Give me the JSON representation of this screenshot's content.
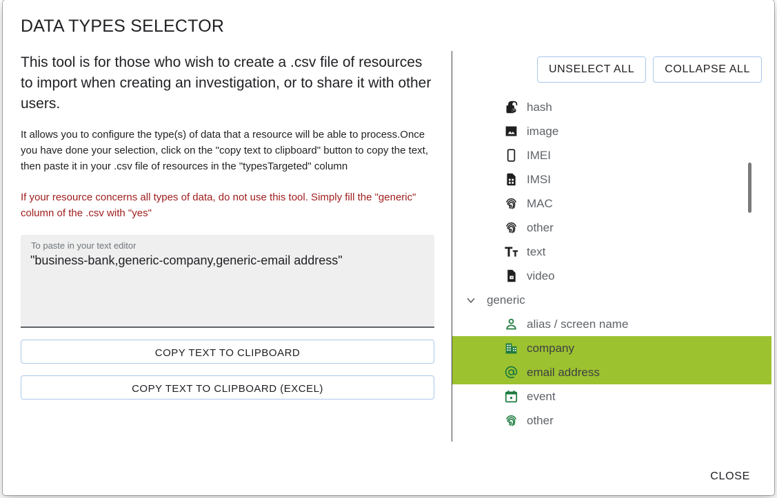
{
  "dialog": {
    "title": "DATA TYPES SELECTOR",
    "close_label": "CLOSE"
  },
  "left": {
    "intro": "This tool is for those who wish to create a .csv file of resources to import when creating an investigation, or to share it with other users.",
    "description": "It allows you to configure the type(s) of data that a resource will be able to process.Once you have done your selection, click on the \"copy text to clipboard\" button to copy the text, then paste it in your .csv file of resources in the \"typesTargeted\" column",
    "warning": "If your resource concerns all types of data, do not use this tool. Simply fill the \"generic\" column of the .csv with \"yes\"",
    "textarea": {
      "label": "To paste in your text editor",
      "value": "\"business-bank,generic-company,generic-email address\"",
      "placeholder": "To paste in your text editor"
    },
    "copy_button": "COPY TEXT TO CLIPBOARD",
    "copy_excel_button": "COPY TEXT TO CLIPBOARD (EXCEL)"
  },
  "right": {
    "unselect_all_label": "UNSELECT ALL",
    "collapse_all_label": "COLLAPSE ALL",
    "tree": [
      {
        "label": "hash",
        "icon": "lock-icon",
        "level": "root",
        "selected": false,
        "expandable": false
      },
      {
        "label": "image",
        "icon": "image-icon",
        "level": "root",
        "selected": false,
        "expandable": false
      },
      {
        "label": "IMEI",
        "icon": "phone-icon",
        "level": "root",
        "selected": false,
        "expandable": false
      },
      {
        "label": "IMSI",
        "icon": "sim-card-icon",
        "level": "root",
        "selected": false,
        "expandable": false
      },
      {
        "label": "MAC",
        "icon": "fingerprint-icon",
        "level": "root",
        "selected": false,
        "expandable": false
      },
      {
        "label": "other",
        "icon": "fingerprint-icon",
        "level": "root",
        "selected": false,
        "expandable": false
      },
      {
        "label": "text",
        "icon": "text-format-icon",
        "level": "root",
        "selected": false,
        "expandable": false
      },
      {
        "label": "video",
        "icon": "video-file-icon",
        "level": "root",
        "selected": false,
        "expandable": false
      },
      {
        "label": "generic",
        "icon": "none",
        "level": "group",
        "selected": false,
        "expandable": true
      },
      {
        "label": "alias / screen name",
        "icon": "person-icon",
        "level": "child",
        "selected": false,
        "expandable": false
      },
      {
        "label": "company",
        "icon": "building-icon",
        "level": "child",
        "selected": true,
        "expandable": false
      },
      {
        "label": "email address",
        "icon": "at-sign-icon",
        "level": "child",
        "selected": true,
        "expandable": false
      },
      {
        "label": "event",
        "icon": "calendar-icon",
        "level": "child",
        "selected": false,
        "expandable": false
      },
      {
        "label": "other",
        "icon": "fingerprint-icon",
        "level": "child",
        "selected": false,
        "expandable": false
      }
    ]
  },
  "colors": {
    "selection_green": "#9dc230",
    "child_icon_green": "#1d7a3e",
    "warning_red": "#9e1b1b",
    "button_border_blue": "#a8c7ea",
    "label_gray": "#5f6368"
  }
}
